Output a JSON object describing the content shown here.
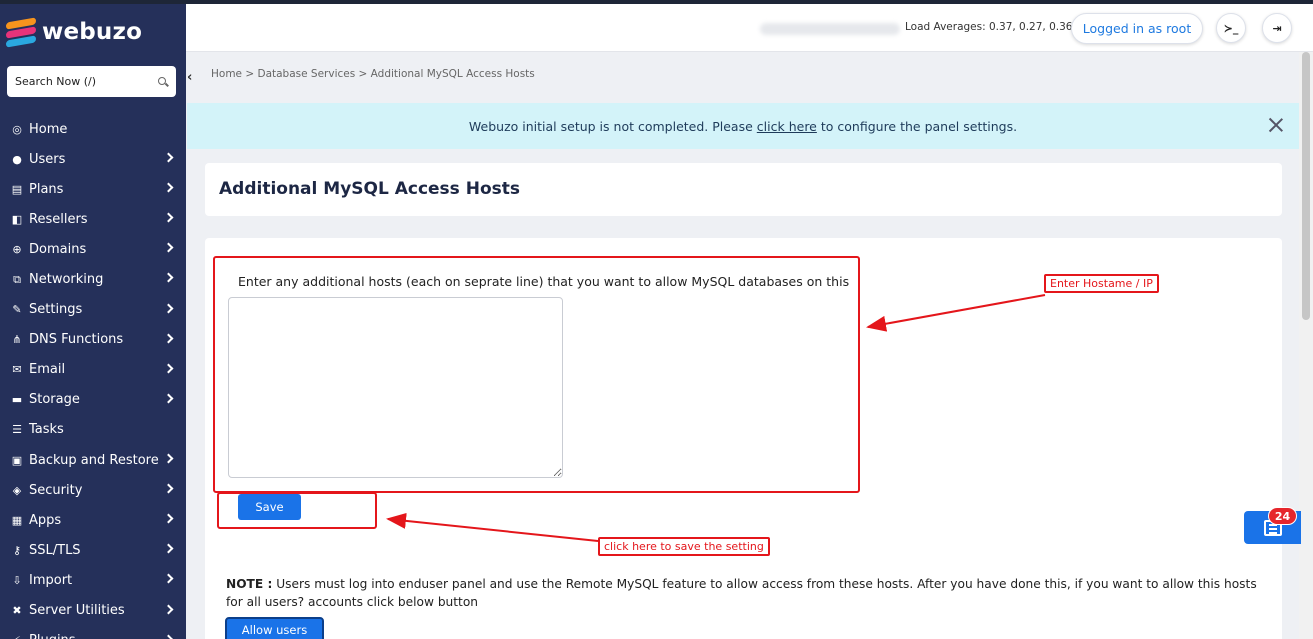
{
  "app": {
    "brand": "webuzo",
    "brand_colors": [
      "#f7941d",
      "#e8337a",
      "#2aa8e0"
    ]
  },
  "sidebar": {
    "search_placeholder": "Search Now (/)",
    "collapse_glyph": "‹",
    "items": [
      {
        "label": "Home",
        "icon": "dashboard-icon",
        "glyph": "◎",
        "has_submenu": false
      },
      {
        "label": "Users",
        "icon": "user-icon",
        "glyph": "●",
        "has_submenu": true
      },
      {
        "label": "Plans",
        "icon": "plans-icon",
        "glyph": "▤",
        "has_submenu": true
      },
      {
        "label": "Resellers",
        "icon": "resellers-icon",
        "glyph": "◧",
        "has_submenu": true
      },
      {
        "label": "Domains",
        "icon": "globe-icon",
        "glyph": "⊕",
        "has_submenu": true
      },
      {
        "label": "Networking",
        "icon": "network-icon",
        "glyph": "⧉",
        "has_submenu": true
      },
      {
        "label": "Settings",
        "icon": "wrench-icon",
        "glyph": "✎",
        "has_submenu": true
      },
      {
        "label": "DNS Functions",
        "icon": "dns-icon",
        "glyph": "⋔",
        "has_submenu": true
      },
      {
        "label": "Email",
        "icon": "envelope-icon",
        "glyph": "✉",
        "has_submenu": true
      },
      {
        "label": "Storage",
        "icon": "storage-icon",
        "glyph": "▬",
        "has_submenu": true
      },
      {
        "label": "Tasks",
        "icon": "tasks-icon",
        "glyph": "☰",
        "has_submenu": false
      },
      {
        "label": "Backup and Restore",
        "icon": "backup-icon",
        "glyph": "▣",
        "has_submenu": true
      },
      {
        "label": "Security",
        "icon": "shield-icon",
        "glyph": "◈",
        "has_submenu": true
      },
      {
        "label": "Apps",
        "icon": "apps-icon",
        "glyph": "▦",
        "has_submenu": true
      },
      {
        "label": "SSL/TLS",
        "icon": "key-icon",
        "glyph": "⚷",
        "has_submenu": true
      },
      {
        "label": "Import",
        "icon": "import-icon",
        "glyph": "⇩",
        "has_submenu": true
      },
      {
        "label": "Server Utilities",
        "icon": "tools-icon",
        "glyph": "✖",
        "has_submenu": true
      },
      {
        "label": "Plugins",
        "icon": "plug-icon",
        "glyph": "⚡",
        "has_submenu": true
      }
    ]
  },
  "header": {
    "load_averages": "Load Averages: 0.37, 0.27, 0.36",
    "logged_in_label": "Logged in as root",
    "terminal_icon_glyph": "≻_",
    "logout_icon_glyph": "⇥"
  },
  "breadcrumb": "Home > Database Services > Additional MySQL Access Hosts",
  "alert": {
    "text_before": "Webuzo initial setup is not completed. Please",
    "link_text": "click here",
    "text_after": "to configure the panel settings."
  },
  "page_title": "Additional MySQL Access Hosts",
  "form": {
    "hosts_label": "Enter any additional hosts (each on seprate line) that you want to allow MySQL databases on this",
    "hosts_value": "",
    "save_label": "Save"
  },
  "note": {
    "prefix": "NOTE :",
    "text": "Users must log into enduser panel and use the Remote MySQL feature to allow access from these hosts. After you have done this, if you want to allow this hosts for all users? accounts click below button"
  },
  "allow_users_label": "Allow users",
  "annotations": {
    "hostname_label": "Enter Hostame / IP",
    "save_label": "click here to save the setting",
    "color": "#e4161b"
  },
  "news_widget": {
    "badge_count": "24"
  }
}
